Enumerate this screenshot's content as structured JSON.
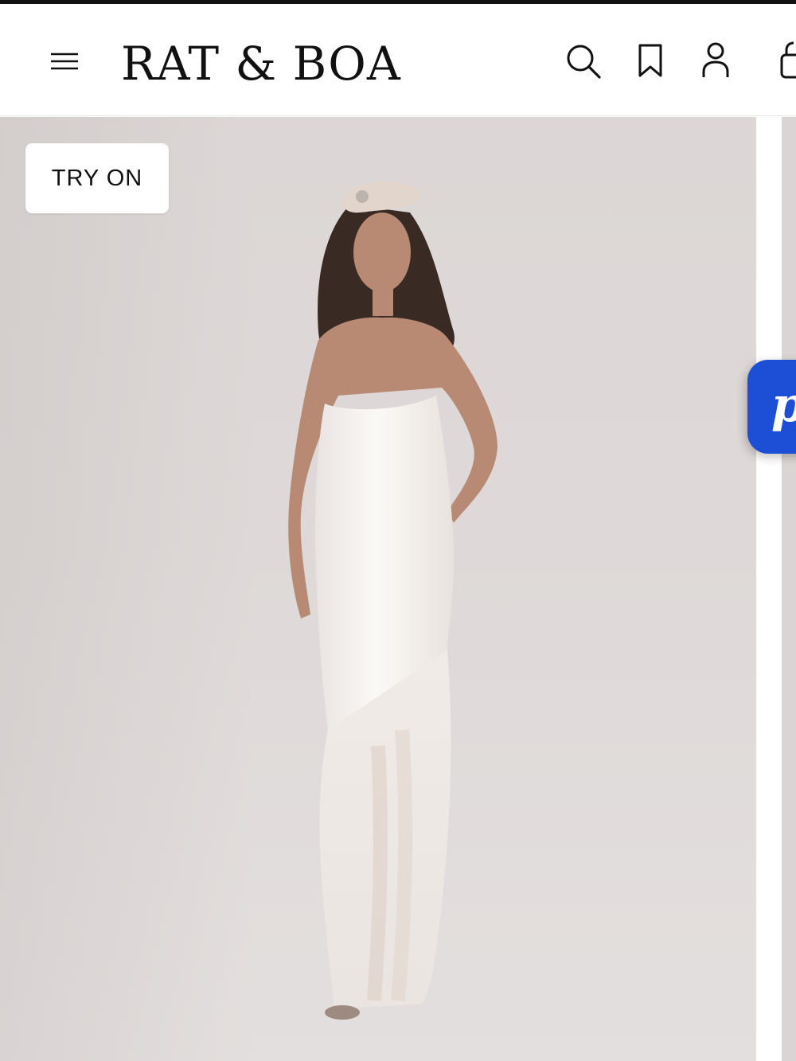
{
  "header": {
    "logo": "RAT & BOA",
    "icons": [
      "menu-icon",
      "search-icon",
      "bookmark-icon",
      "account-icon",
      "bag-icon"
    ]
  },
  "gallery": {
    "try_on_label": "TRY ON",
    "image_description_icon": "product-photo"
  },
  "chat_widget": {
    "glyph": "p"
  },
  "colors": {
    "accent": "#1d4fd6",
    "text": "#111111",
    "background": "#ffffff",
    "photo_background": "#ddd8d7"
  }
}
